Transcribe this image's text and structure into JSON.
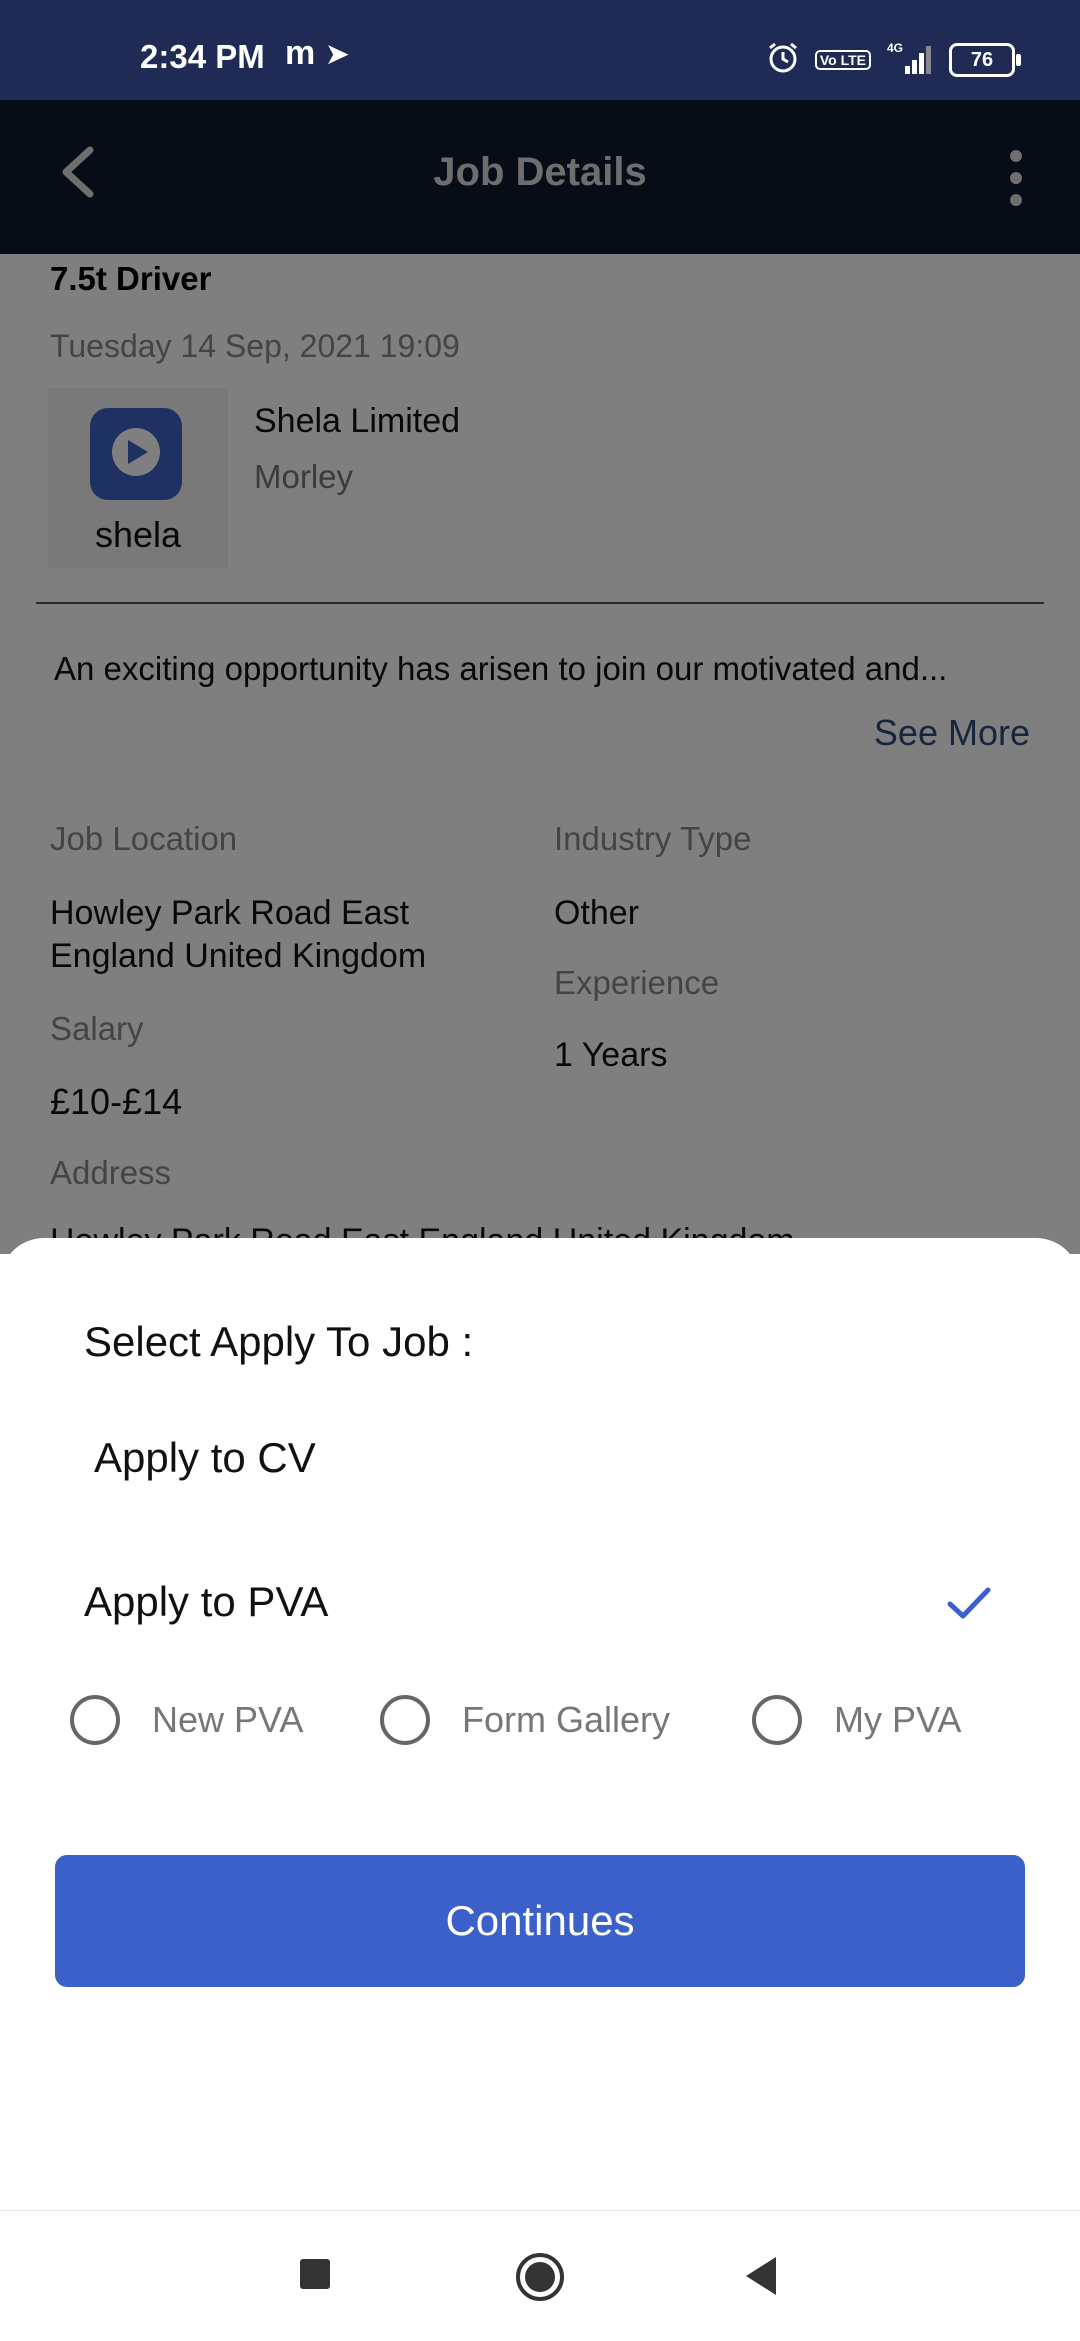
{
  "status_bar": {
    "time": "2:34 PM",
    "battery": "76",
    "network": "4G",
    "volte": "Vo LTE"
  },
  "app_bar": {
    "title": "Job Details"
  },
  "job": {
    "title": "7.5t Driver",
    "date": "Tuesday 14 Sep, 2021 19:09",
    "company_name": "Shela Limited",
    "company_city": "Morley",
    "logo_text": "shela",
    "description": "An exciting opportunity has arisen to join our motivated and...",
    "see_more": "See More",
    "job_location_label": "Job Location",
    "job_location_line1": "Howley Park Road East",
    "job_location_line2": "England United Kingdom",
    "industry_type_label": "Industry Type",
    "industry_type": "Other",
    "experience_label": "Experience",
    "experience": "1 Years",
    "salary_label": "Salary",
    "salary": "£10-£14",
    "address_label": "Address",
    "address_partial": "Howley Park Road East England United Kingdom"
  },
  "sheet": {
    "title": "Select Apply To Job :",
    "option_cv": "Apply to CV",
    "option_pva": "Apply to PVA",
    "radio_options": [
      "New PVA",
      "Form Gallery",
      "My PVA"
    ],
    "continue_label": "Continues"
  },
  "colors": {
    "status_bar": "#1f2a55",
    "app_bar": "#0f1a2c",
    "accent": "#3b60c9",
    "see_more": "#2b4d7c"
  },
  "icons": {
    "back": "back-arrow-icon",
    "more": "more-vertical-icon",
    "check": "check-icon",
    "nav_recents": "square-icon",
    "nav_home": "circle-icon",
    "nav_back": "triangle-back-icon"
  }
}
